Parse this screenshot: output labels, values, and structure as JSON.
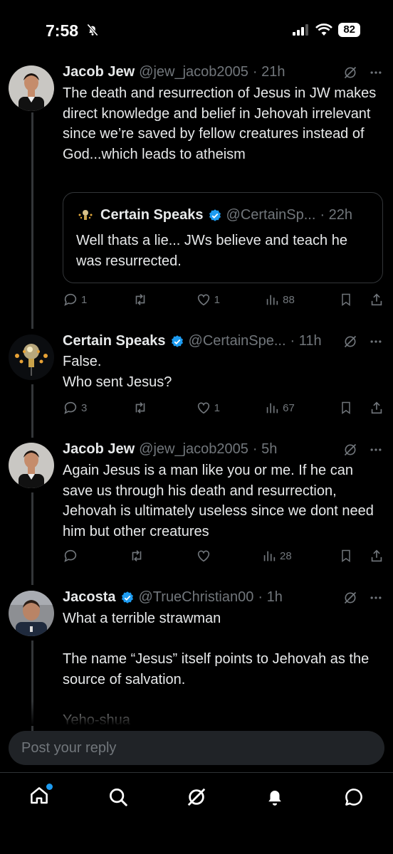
{
  "status_bar": {
    "time": "7:58",
    "battery": "82"
  },
  "posts": [
    {
      "name": "Jacob Jew",
      "handle": "@jew_jacob2005",
      "time": "· 21h",
      "verified": false,
      "text": "The death and resurrection of Jesus in JW makes direct knowledge and belief in Jehovah irrelevant since we’re saved by fellow creatures instead of God...which leads to atheism",
      "quote": {
        "name": "Certain Speaks",
        "handle": "@CertainSp...",
        "time": "· 22h",
        "text": "Well thats a lie... JWs believe and teach he was resurrected."
      },
      "replies": "1",
      "reposts": "",
      "likes": "1",
      "views": "88"
    },
    {
      "name": "Certain Speaks",
      "handle": "@CertainSpe...",
      "time": "· 11h",
      "verified": true,
      "text": "False.\nWho sent Jesus?",
      "replies": "3",
      "reposts": "",
      "likes": "1",
      "views": "67"
    },
    {
      "name": "Jacob Jew",
      "handle": "@jew_jacob2005",
      "time": "· 5h",
      "verified": false,
      "text": "Again Jesus is a man like you or me. If he can save us through his death and resurrection, Jehovah is ultimately useless since we dont need him but other creatures",
      "replies": "",
      "reposts": "",
      "likes": "",
      "views": "28"
    },
    {
      "name": "Jacosta",
      "handle": "@TrueChristian00",
      "time": "· 1h",
      "verified": true,
      "text": "What a terrible strawman\n\nThe name “Jesus” itself points to Jehovah as the source of salvation.\n\nYeho-shua"
    }
  ],
  "reply_box": {
    "placeholder": "Post your reply"
  },
  "tabbar": [
    "home-icon",
    "search-icon",
    "grok-icon",
    "notifications-icon",
    "messages-icon"
  ],
  "colors": {
    "background": "#000000",
    "text": "#e7e9ea",
    "muted": "#71767b",
    "verified": "#1d9bf0",
    "notification_dot": "#1d9bf0"
  }
}
